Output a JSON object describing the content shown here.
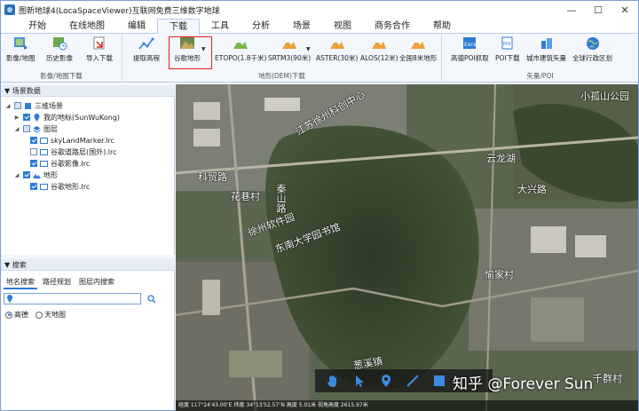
{
  "window": {
    "title": "图新地球4(LocaSpaceViewer)互联网免费三维数字地球",
    "controls": [
      "—",
      "☐",
      "✕"
    ]
  },
  "tabs": [
    "开始",
    "在线地图",
    "编辑",
    "下载",
    "工具",
    "分析",
    "场景",
    "视图",
    "商务合作",
    "帮助"
  ],
  "ribbon": {
    "group1": {
      "label": "影像/地图下载",
      "buttons": [
        "影像/地图",
        "历史影像",
        "导入下载"
      ]
    },
    "group2": {
      "label": "地形(DEM)下载",
      "buttons": [
        "提取高程",
        "谷歌地形",
        "ETOPO(1.8千米)",
        "SRTM3(90米)",
        "ASTER(30米)",
        "ALOS(12米)",
        "全国8米地形"
      ]
    },
    "group3": {
      "label": "矢量/POI",
      "buttons": [
        "高德POI抓取",
        "POI下载",
        "城市建筑矢量",
        "全球行政区划"
      ]
    },
    "colors": {
      "highlight": "#e02020",
      "accent": "#2d7bd6"
    }
  },
  "scene_panel": {
    "title": "场景数据",
    "tree": {
      "root": "三维场景",
      "my_place": "我的地标(SunWuKong)",
      "layers": "图层",
      "layer_items": [
        "skyLandMarker.lrc",
        "谷歌道路层(国外).lrc",
        "谷歌影像.lrc"
      ],
      "terrain": "地形",
      "terrain_items": [
        "谷歌地形.lrc"
      ]
    }
  },
  "search_panel": {
    "title": "搜索",
    "tabs": [
      "地名搜索",
      "路径规划",
      "图层内搜索"
    ],
    "input_value": "",
    "sources": [
      "高德",
      "天地图"
    ],
    "selected_source": "高德"
  },
  "map": {
    "labels": [
      "小孤山公园",
      "江苏徐州科创中心",
      "科贸路",
      "花巷村",
      "秦山路",
      "徐州软件园",
      "东南大学园书馆",
      "云龙湖",
      "大兴路",
      "愉家村",
      "葱溪镇",
      "千群村"
    ],
    "watermark": "知乎 @Forever Sun",
    "status": "经度 117°24′43.00″E 纬度 34°13′52.57″N 高度 5.01米    视角高度 2615.97米"
  }
}
